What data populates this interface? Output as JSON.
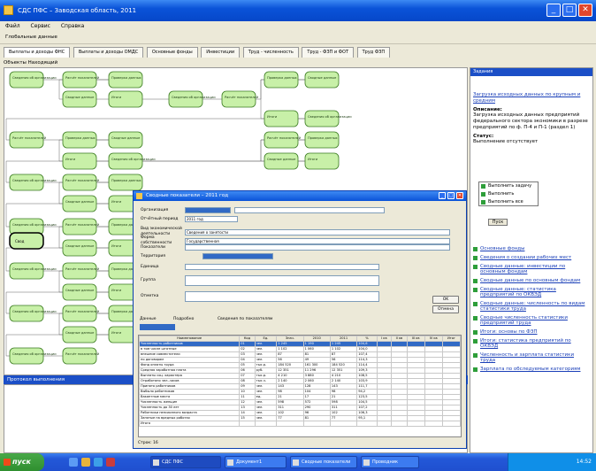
{
  "window": {
    "title": "СДС ПФС – Заводская область, 2011",
    "buttons": [
      "_",
      "□",
      "✕"
    ],
    "menu": [
      "Файл",
      "Сервис",
      "Справка"
    ],
    "toolbar": [
      "Глобальные данные"
    ]
  },
  "tabs": [
    "Выплаты и доходы ФНС",
    "Выплаты и доходы ОМДС",
    "Основные фонды",
    "Инвестиции",
    "Труд - численность",
    "Труд - ФЗП и ФОТ",
    "Труд ФЗП"
  ],
  "subbar": "Объекты    Находящий",
  "flow_nodes": {
    "root": "Свод",
    "labels": [
      "Сведения об организации",
      "Расчёт показателей",
      "Проверка данных",
      "Сводные данные",
      "Итоги"
    ]
  },
  "protocol": {
    "title": "Протокол выполнения"
  },
  "right_panel": {
    "title": "Задания",
    "link_top": "Загрузка исходных данных по крупным и средним",
    "section1_head": "Описание:",
    "section1_text": "Загрузка исходных данных предприятий федерального сектора экономики в разрезе предприятий по ф. П-4 и П-1 (раздел 1)",
    "section2_head": "Статус:",
    "section2_text": "Выполнение отсутствует",
    "items": [
      "Основные фонды",
      "Сведения о создании рабочих мест",
      "Сводные данные: инвестиции по основным фондам",
      "Сводные данные по основным фондам",
      "Сводные данные: статистика предприятий по ОКВЭД",
      "Сводные данные: численность по видам статистики труда",
      "Сводные численность статистики предприятий труда",
      "Итоги: основы по ФЗП",
      "Итоги: статистика предприятий по ОКВЭД",
      "Численность и зарплата статистики труда",
      "Зарплата по обследуемым категориям"
    ]
  },
  "popup": {
    "items": [
      "Выполнить задачу",
      "Выполнить",
      "Выполнить все"
    ],
    "ok": "Пуск"
  },
  "dialog": {
    "title": "Сводные показатели – 2011 год",
    "fields": [
      {
        "label": "Организация",
        "value": ""
      },
      {
        "label": "Отчётный период",
        "value": "2011 год"
      },
      {
        "label": "Вид экономической деятельности",
        "value": "Сведения о занятости"
      },
      {
        "label": "Форма собственности",
        "value": "Государственная"
      },
      {
        "label": "Показатели",
        "value": ""
      },
      {
        "label": "Территория",
        "value": ""
      },
      {
        "label": "Единица",
        "value": ""
      },
      {
        "label": "Группа",
        "value": ""
      },
      {
        "label": "Отметка",
        "value": ""
      }
    ],
    "btn_ok": "OK",
    "btn_cancel": "Отмена",
    "tabs": [
      "Данные",
      "Подробно",
      "Сведения по показателям"
    ],
    "grid_headers": [
      "Наименование",
      "Код",
      "Ед.",
      "Знач.",
      "2010",
      "2011",
      "%",
      "I кв",
      "II кв",
      "III кв",
      "IV кв",
      "Итог"
    ],
    "grid_rows": [
      [
        "Численность работников",
        "01",
        "чел.",
        "1 245",
        "1 190",
        "1 245",
        "104,6",
        "",
        "",
        "",
        "",
        ""
      ],
      [
        "в том числе штатные",
        "02",
        "чел.",
        "1 102",
        "1 060",
        "1 102",
        "104,0",
        "",
        "",
        "",
        "",
        ""
      ],
      [
        "внешние совместители",
        "03",
        "чел.",
        "87",
        "81",
        "87",
        "107,4",
        "",
        "",
        "",
        "",
        ""
      ],
      [
        "по договорам",
        "04",
        "чел.",
        "56",
        "49",
        "56",
        "114,3",
        "",
        "",
        "",
        "",
        ""
      ],
      [
        "Фонд оплаты труда",
        "05",
        "тыс.р.",
        "184 520",
        "161 300",
        "184 520",
        "114,4",
        "",
        "",
        "",
        "",
        ""
      ],
      [
        "Средняя заработная плата",
        "06",
        "руб.",
        "12 351",
        "11 296",
        "12 351",
        "109,3",
        "",
        "",
        "",
        "",
        ""
      ],
      [
        "Выплаты соц. характера",
        "07",
        "тыс.р.",
        "4 210",
        "3 880",
        "4 210",
        "108,5",
        "",
        "",
        "",
        "",
        ""
      ],
      [
        "Отработано чел.-часов",
        "08",
        "тыс.ч.",
        "2 140",
        "2 060",
        "2 140",
        "103,9",
        "",
        "",
        "",
        "",
        ""
      ],
      [
        "Принято работников",
        "09",
        "чел.",
        "143",
        "128",
        "143",
        "111,7",
        "",
        "",
        "",
        "",
        ""
      ],
      [
        "Выбыло работников",
        "10",
        "чел.",
        "98",
        "104",
        "98",
        "94,2",
        "",
        "",
        "",
        "",
        ""
      ],
      [
        "Вакантные места",
        "11",
        "ед.",
        "21",
        "17",
        "21",
        "123,5",
        "",
        "",
        "",
        "",
        ""
      ],
      [
        "Численность женщин",
        "12",
        "чел.",
        "598",
        "572",
        "598",
        "104,5",
        "",
        "",
        "",
        "",
        ""
      ],
      [
        "Численность до 30 лет",
        "13",
        "чел.",
        "311",
        "290",
        "311",
        "107,2",
        "",
        "",
        "",
        "",
        ""
      ],
      [
        "Работники пенсионного возраста",
        "14",
        "чел.",
        "102",
        "96",
        "102",
        "106,3",
        "",
        "",
        "",
        "",
        ""
      ],
      [
        "Занятые на вредных работах",
        "15",
        "чел.",
        "77",
        "81",
        "77",
        "95,1",
        "",
        "",
        "",
        "",
        ""
      ],
      [
        "Итого",
        "",
        "",
        "",
        "",
        "",
        "",
        "",
        "",
        "",
        "",
        ""
      ]
    ],
    "status": "Строк: 16"
  },
  "taskbar": {
    "start": "пуск",
    "tasks": [
      "СДС ПФС",
      "Документ1",
      "Сводные показатели",
      "Проводник"
    ],
    "clock": "14:52"
  }
}
